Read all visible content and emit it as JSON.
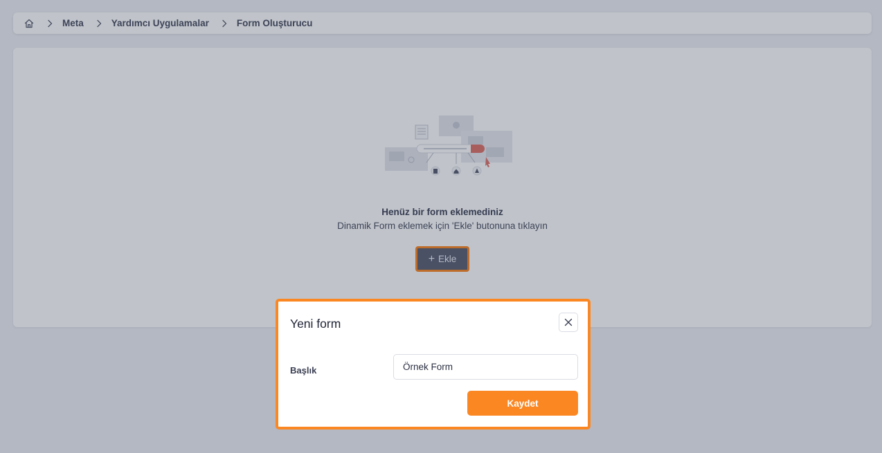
{
  "breadcrumb": {
    "items": [
      "Meta",
      "Yardımcı Uygulamalar",
      "Form Oluşturucu"
    ]
  },
  "empty_state": {
    "title": "Henüz bir form eklemediniz",
    "subtitle": "Dinamik Form eklemek için 'Ekle' butonuna tıklayın",
    "add_button_label": "Ekle",
    "illustration": "empty-form-illustration"
  },
  "modal": {
    "title": "Yeni form",
    "field_label": "Başlık",
    "field_value": "Örnek Form",
    "save_label": "Kaydet"
  },
  "colors": {
    "accent": "#fb8723",
    "background": "#eef0f5",
    "add_button_bg": "#5c6175"
  },
  "icons": {
    "home": "home-icon",
    "separator": "chevron-right-icon",
    "add": "plus-icon",
    "close": "close-icon"
  }
}
